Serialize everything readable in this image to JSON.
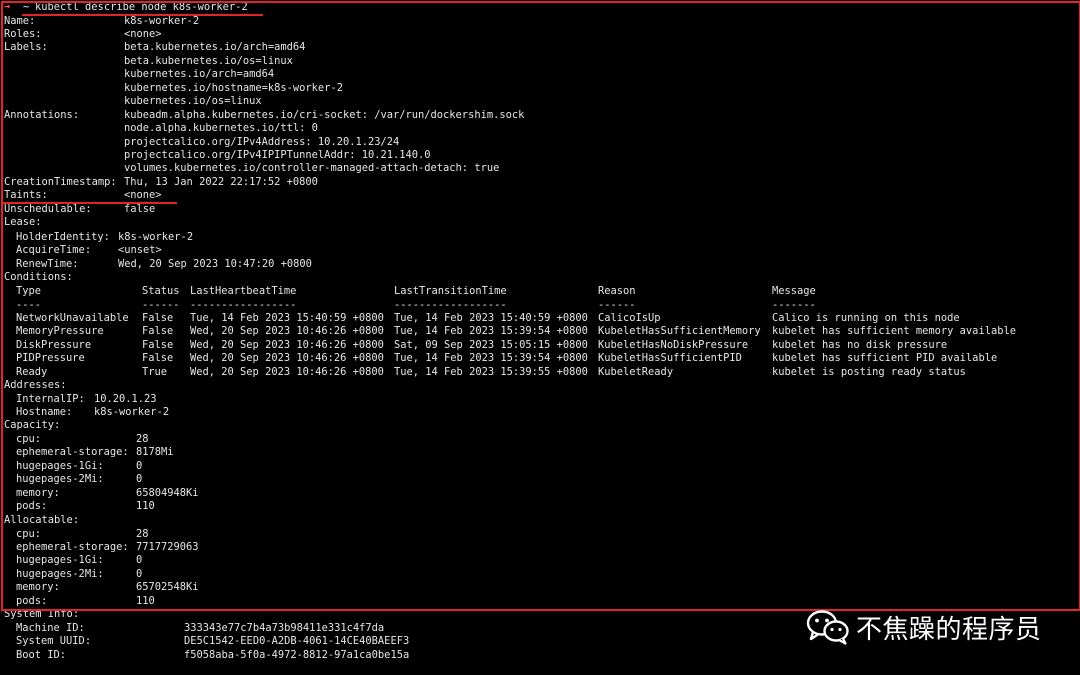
{
  "colors": {
    "background": "#000000",
    "text": "#e6e6e6",
    "annotation_red": "#e0242a"
  },
  "terminal": {
    "prompt_symbol": "➜",
    "prompt_tilde": "~",
    "command": "kubectl describe node k8s-worker-2",
    "lines": [
      {
        "k": "Name:",
        "v": "k8s-worker-2"
      },
      {
        "k": "Roles:",
        "v": "<none>"
      },
      {
        "k": "Labels:",
        "v": "beta.kubernetes.io/arch=amd64"
      },
      {
        "k": "",
        "v": "beta.kubernetes.io/os=linux"
      },
      {
        "k": "",
        "v": "kubernetes.io/arch=amd64"
      },
      {
        "k": "",
        "v": "kubernetes.io/hostname=k8s-worker-2"
      },
      {
        "k": "",
        "v": "kubernetes.io/os=linux"
      },
      {
        "k": "Annotations:",
        "v": "kubeadm.alpha.kubernetes.io/cri-socket: /var/run/dockershim.sock"
      },
      {
        "k": "",
        "v": "node.alpha.kubernetes.io/ttl: 0"
      },
      {
        "k": "",
        "v": "projectcalico.org/IPv4Address: 10.20.1.23/24"
      },
      {
        "k": "",
        "v": "projectcalico.org/IPv4IPIPTunnelAddr: 10.21.140.0"
      },
      {
        "k": "",
        "v": "volumes.kubernetes.io/controller-managed-attach-detach: true"
      },
      {
        "k": "CreationTimestamp:",
        "v": "Thu, 13 Jan 2022 22:17:52 +0800"
      },
      {
        "k": "Taints:",
        "v": "<none>"
      },
      {
        "k": "Unschedulable:",
        "v": "false"
      },
      {
        "k": "Lease:",
        "v": ""
      }
    ],
    "lease": [
      {
        "k": "HolderIdentity:",
        "v": "k8s-worker-2"
      },
      {
        "k": "AcquireTime:",
        "v": "<unset>"
      },
      {
        "k": "RenewTime:",
        "v": "Wed, 20 Sep 2023 10:47:20 +0800"
      }
    ],
    "conditions_label": "Conditions:",
    "conditions_header": [
      "Type",
      "Status",
      "LastHeartbeatTime",
      "LastTransitionTime",
      "Reason",
      "Message"
    ],
    "conditions_dashes": [
      "----",
      "------",
      "-----------------",
      "------------------",
      "------",
      "-------"
    ],
    "conditions": [
      [
        "NetworkUnavailable",
        "False",
        "Tue, 14 Feb 2023 15:40:59 +0800",
        "Tue, 14 Feb 2023 15:40:59 +0800",
        "CalicoIsUp",
        "Calico is running on this node"
      ],
      [
        "MemoryPressure",
        "False",
        "Wed, 20 Sep 2023 10:46:26 +0800",
        "Tue, 14 Feb 2023 15:39:54 +0800",
        "KubeletHasSufficientMemory",
        "kubelet has sufficient memory available"
      ],
      [
        "DiskPressure",
        "False",
        "Wed, 20 Sep 2023 10:46:26 +0800",
        "Sat, 09 Sep 2023 15:05:15 +0800",
        "KubeletHasNoDiskPressure",
        "kubelet has no disk pressure"
      ],
      [
        "PIDPressure",
        "False",
        "Wed, 20 Sep 2023 10:46:26 +0800",
        "Tue, 14 Feb 2023 15:39:54 +0800",
        "KubeletHasSufficientPID",
        "kubelet has sufficient PID available"
      ],
      [
        "Ready",
        "True",
        "Wed, 20 Sep 2023 10:46:26 +0800",
        "Tue, 14 Feb 2023 15:39:55 +0800",
        "KubeletReady",
        "kubelet is posting ready status"
      ]
    ],
    "addresses_label": "Addresses:",
    "addresses": [
      {
        "k": "InternalIP:",
        "v": "10.20.1.23"
      },
      {
        "k": "Hostname:",
        "v": "k8s-worker-2"
      }
    ],
    "capacity_label": "Capacity:",
    "capacity": [
      {
        "k": "cpu:",
        "v": "28"
      },
      {
        "k": "ephemeral-storage:",
        "v": "8178Mi"
      },
      {
        "k": "hugepages-1Gi:",
        "v": "0"
      },
      {
        "k": "hugepages-2Mi:",
        "v": "0"
      },
      {
        "k": "memory:",
        "v": "65804948Ki"
      },
      {
        "k": "pods:",
        "v": "110"
      }
    ],
    "allocatable_label": "Allocatable:",
    "allocatable": [
      {
        "k": "cpu:",
        "v": "28"
      },
      {
        "k": "ephemeral-storage:",
        "v": "7717729063"
      },
      {
        "k": "hugepages-1Gi:",
        "v": "0"
      },
      {
        "k": "hugepages-2Mi:",
        "v": "0"
      },
      {
        "k": "memory:",
        "v": "65702548Ki"
      },
      {
        "k": "pods:",
        "v": "110"
      }
    ],
    "system_info_label": "System Info:",
    "system_info": [
      {
        "k": "Machine ID:",
        "v": "333343e77c7b4a73b98411e331c4f7da"
      },
      {
        "k": "System UUID:",
        "v": "DE5C1542-EED0-A2DB-4061-14CE40BAEEF3"
      },
      {
        "k": "Boot ID:",
        "v": "f5058aba-5f0a-4972-8812-97a1ca0be15a"
      }
    ]
  },
  "watermark": {
    "icon": "wechat-icon",
    "text": "不焦躁的程序员"
  }
}
